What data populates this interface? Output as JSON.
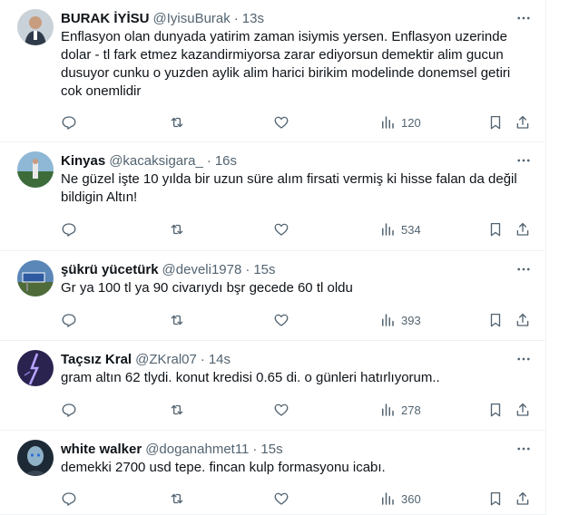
{
  "tweets": [
    {
      "name": "BURAK İYİSU",
      "handle": "@IyisuBurak",
      "dot": "·",
      "time": "13s",
      "text": "Enflasyon olan dunyada yatirim zaman isiymis yersen. Enflasyon uzerinde dolar - tl fark etmez kazandirmiyorsa zarar ediyorsun demektir alim gucun dusuyor cunku o yuzden aylik alim harici birikim modelinde donemsel getiri cok onemlidir",
      "views": "120",
      "avatar_colors": [
        "#c9d1d9",
        "#2f3b4a"
      ]
    },
    {
      "name": "Kinyas",
      "handle": "@kacaksigara_",
      "dot": "·",
      "time": "16s",
      "text": "Ne güzel işte 10 yılda bir uzun süre alım firsati vermiş ki hisse falan da değil bildigin Altın!",
      "views": "534",
      "avatar_colors": [
        "#8fb7d6",
        "#3d6b3a"
      ]
    },
    {
      "name": "şükrü yücetürk",
      "handle": "@develi1978",
      "dot": "·",
      "time": "15s",
      "text": "Gr ya 100 tl ya 90 civarıydı bşr gecede 60 tl oldu",
      "views": "393",
      "avatar_colors": [
        "#5a87b8",
        "#4f6b3a"
      ]
    },
    {
      "name": "Taçsız Kral",
      "handle": "@ZKral07",
      "dot": "·",
      "time": "14s",
      "text": "gram altın 62 tlydi. konut kredisi 0.65 di. o günleri hatırlıyorum..",
      "views": "278",
      "avatar_colors": [
        "#2a2350",
        "#b8a4ff"
      ]
    },
    {
      "name": "white walker",
      "handle": "@doganahmet11",
      "dot": "·",
      "time": "15s",
      "text": "demekki 2700 usd tepe. fincan kulp formasyonu icabı.",
      "views": "360",
      "avatar_colors": [
        "#1d2a36",
        "#8fb2c9"
      ]
    }
  ],
  "colors": {
    "text_primary": "#0f1419",
    "text_secondary": "#536471",
    "border": "#eff3f4"
  },
  "icons": [
    "reply-icon",
    "retweet-icon",
    "like-icon",
    "views-icon",
    "bookmark-icon",
    "share-icon",
    "more-icon"
  ]
}
